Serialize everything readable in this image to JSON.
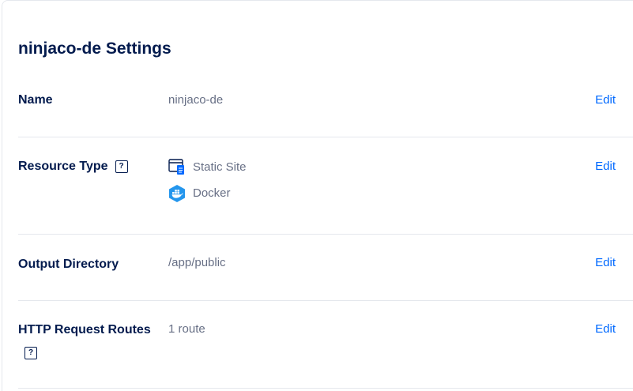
{
  "settings": {
    "title": "ninjaco-de Settings",
    "edit_label": "Edit",
    "help_glyph": "?",
    "rows": {
      "name": {
        "label": "Name",
        "value": "ninjaco-de"
      },
      "resource_type": {
        "label": "Resource Type",
        "types": [
          {
            "label": "Static Site",
            "icon": "static-site-icon"
          },
          {
            "label": "Docker",
            "icon": "docker-icon"
          }
        ]
      },
      "output_directory": {
        "label": "Output Directory",
        "value": "/app/public"
      },
      "http_routes": {
        "label": "HTTP Request Routes",
        "value": "1 route"
      }
    }
  },
  "colors": {
    "heading": "#031b4e",
    "muted": "#676f85",
    "link": "#0069ff",
    "divider": "#e5e8ed",
    "docker": "#2496ed"
  }
}
